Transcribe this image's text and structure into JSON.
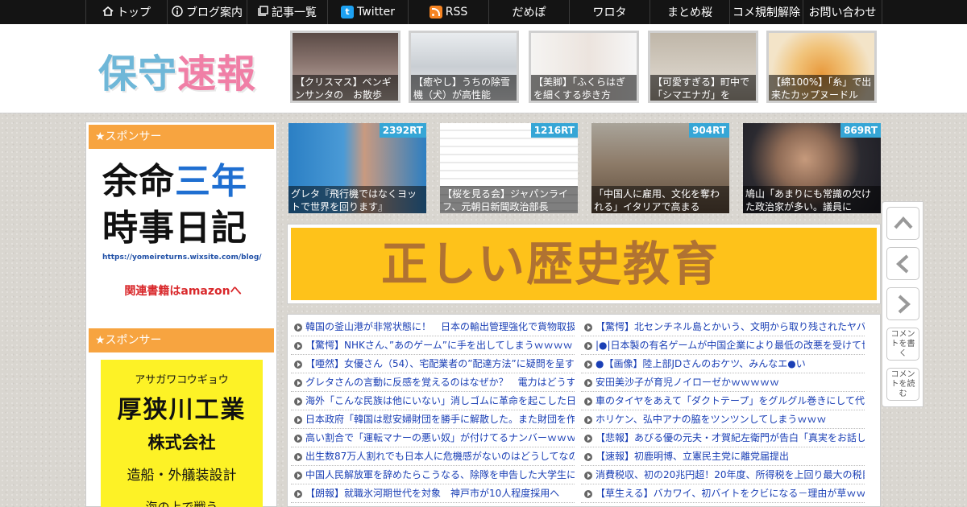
{
  "nav": {
    "items": [
      {
        "label": "トップ",
        "icon": "home-icon"
      },
      {
        "label": "ブログ案内",
        "icon": "info-icon"
      },
      {
        "label": "記事一覧",
        "icon": "list-icon"
      },
      {
        "label": "Twitter",
        "icon": "twitter-icon"
      },
      {
        "label": "RSS",
        "icon": "rss-icon"
      },
      {
        "label": "だめぽ"
      },
      {
        "label": "ワロタ"
      },
      {
        "label": "まとめ桜"
      },
      {
        "label": "コメ規制解除"
      },
      {
        "label": "お問い合わせ"
      }
    ]
  },
  "header": {
    "logo_text_1": "保守",
    "logo_text_2": "速報",
    "thumbs": [
      {
        "caption": "【クリスマス】ペンギンサンタの　お散歩"
      },
      {
        "caption": "【癒やし】うちの除雪機（犬）が高性能"
      },
      {
        "caption": "【美脚】「ふくらはぎを細くする歩き方"
      },
      {
        "caption": "【可愛すぎる】町中で「シマエナガ」を"
      },
      {
        "caption": "【綿100%】「糸」で出来たカップヌードル"
      }
    ]
  },
  "sidebar": {
    "sponsor_label_1": "★スポンサー",
    "ad1": {
      "line1a": "余命",
      "line1b": "三年",
      "line2": "時事日記",
      "url": "https://yomeireturns.wixsite.com/blog/",
      "amazon": "関連書籍はamazonへ"
    },
    "sponsor_label_2": "★スポンサー",
    "ad2": {
      "kana": "アサガワコウギョウ",
      "name": "厚狭川工業",
      "type": "株式会社",
      "desc": "造船・外艤装設計",
      "tag": "海の上で戦う"
    }
  },
  "rt_thumbs": [
    {
      "rt": "2392RT",
      "caption": "グレタ『飛行機ではなくヨットで世界を回ります』"
    },
    {
      "rt": "1216RT",
      "caption": "【桜を見る会】ジャパンライフ、元朝日新聞政治部長"
    },
    {
      "rt": "904RT",
      "caption": "「中国人に雇用、文化を奪われる」イタリアで高まる"
    },
    {
      "rt": "869RT",
      "caption": "鳩山「あまりにも常識の欠けた政治家が多い。議員に"
    }
  ],
  "banner": {
    "text": "正しい歴史教育"
  },
  "links": {
    "left": [
      "韓国の釜山港が非常状態に！　日本の輸出管理強化で貨物取扱",
      "【驚愕】NHKさん、”あのゲーム”に手を出してしまうｗｗｗｗ",
      "【唖然】女優さん（54）、宅配業者の”配達方法”に疑問を呈す",
      "グレタさんの言動に反感を覚えるのはなぜか？　電力はどうす",
      "海外「こんな民族は他にいない」消しゴムに革命を起こした日",
      "日本政府「韓国は慰安婦財団を勝手に解散した。また財団を作",
      "高い割合で「運転マナーの悪い奴」が付けてるナンバーｗｗｗ",
      "出生数87万人割れでも日本人に危機感がないのはどうしてなの",
      "中国人民解放軍を辞めたらこうなる、除隊を申告した大学生に",
      "【朗報】就職氷河期世代を対象　神戸市が10人程度採用へ"
    ],
    "right": [
      "【驚愕】北センチネル島とかいう、文明から取り残されたヤバ",
      "|●|日本製の有名ゲームが中国企業により最低の改悪を受けて世",
      "●【画像】陸上部JDさんのおケツ、みんなエ●い",
      "安田美沙子が育児ノイローゼかｗｗｗｗｗ",
      "車のタイヤをあえて「ダクトテープ」をグルグル巻きにして代",
      "ホリケン、弘中アナの脇をツンツンしてしまうｗｗｗ",
      "【悲報】あびる優の元夫・才賀紀左衛門が告白「真実をお話し",
      "【速報】初鹿明博、立憲民主党に離党届提出",
      "消費税収、初の20兆円超！20年度、所得税を上回り最大の税目",
      "【草生える】バカワイ、初バイトをクビになる－理由が草ｗｗ"
    ]
  },
  "floatbar": {
    "comment_write": "コメントを書く",
    "comment_read": "コメントを読む"
  },
  "colors": {
    "nav_bg": "#141414",
    "sponsor_orange": "#f7a440",
    "rt_badge": "#36a6d6",
    "link_blue": "#1a3fb5",
    "banner_yellow": "#fec21a"
  }
}
